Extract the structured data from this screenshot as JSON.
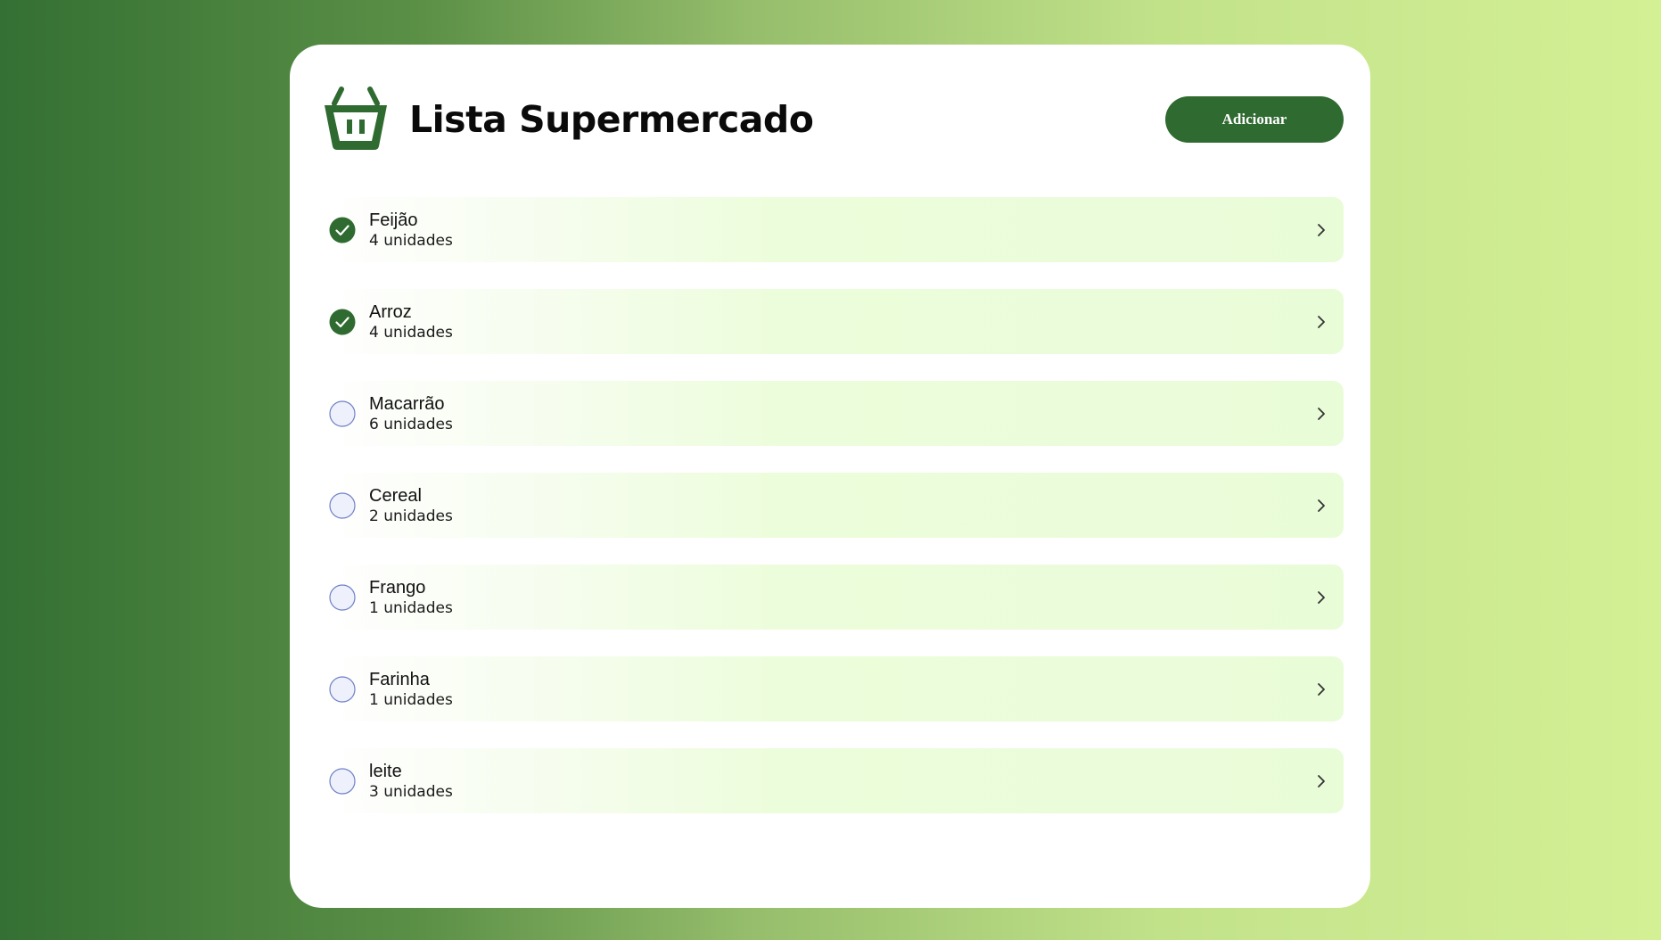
{
  "app": {
    "title": "Lista Supermercado",
    "add_button_label": "Adicionar",
    "icon": "basket-icon",
    "accent_color": "#2f6a30"
  },
  "items": [
    {
      "name": "Feijão",
      "quantity": "4 unidades",
      "checked": true
    },
    {
      "name": "Arroz",
      "quantity": "4 unidades",
      "checked": true
    },
    {
      "name": "Macarrão",
      "quantity": "6 unidades",
      "checked": false
    },
    {
      "name": "Cereal",
      "quantity": "2 unidades",
      "checked": false
    },
    {
      "name": "Frango",
      "quantity": "1 unidades",
      "checked": false
    },
    {
      "name": "Farinha",
      "quantity": "1 unidades",
      "checked": false
    },
    {
      "name": "leite",
      "quantity": "3 unidades",
      "checked": false
    }
  ],
  "icons": {
    "checked": "check-circle-icon",
    "unchecked": "empty-circle-icon",
    "row_action": "chevron-right-icon"
  }
}
